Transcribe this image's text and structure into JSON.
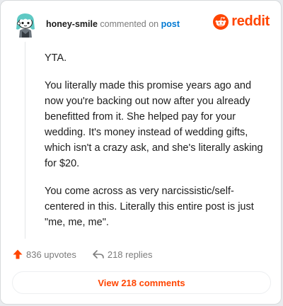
{
  "header": {
    "username": "honey-smile",
    "action_text": "commented on",
    "link_text": "post",
    "brand_name": "reddit"
  },
  "comment": {
    "paragraphs": [
      "YTA.",
      "You literally made this promise years ago and now you're backing out now after you already benefitted from it. She helped pay for your wedding. It's money instead of wedding gifts, which isn't a crazy ask, and she's literally asking for $20.",
      "You come across as very narcissistic/self-centered in this. Literally this entire post is just \"me, me, me\"."
    ]
  },
  "footer": {
    "upvotes": "836 upvotes",
    "replies": "218 replies",
    "view_comments": "View 218 comments"
  },
  "colors": {
    "brand": "#ff4500",
    "link": "#0079d3",
    "muted": "#7c7c7c",
    "avatar_hair": "#5fc9c4"
  },
  "icons": {
    "avatar": "snoo-avatar",
    "brand": "reddit-logo-icon",
    "upvote": "upvote-arrow-icon",
    "reply": "reply-arrow-icon"
  }
}
